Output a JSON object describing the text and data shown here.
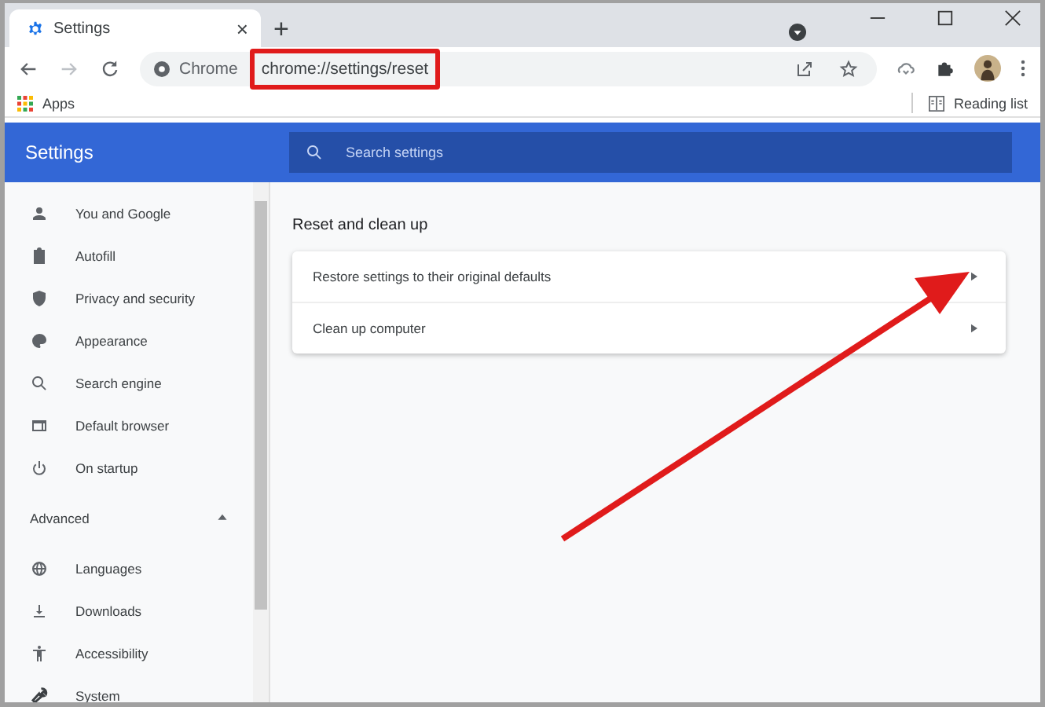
{
  "tab": {
    "title": "Settings",
    "close": "×"
  },
  "new_tab": "+",
  "toolbar": {
    "site_label": "Chrome",
    "url": "chrome://settings/reset"
  },
  "bookmarks": {
    "apps": "Apps",
    "reading_list": "Reading list"
  },
  "header": {
    "title": "Settings",
    "search": {
      "placeholder": "Search settings"
    }
  },
  "sidebar": {
    "items": [
      {
        "label": "You and Google"
      },
      {
        "label": "Autofill"
      },
      {
        "label": "Privacy and security"
      },
      {
        "label": "Appearance"
      },
      {
        "label": "Search engine"
      },
      {
        "label": "Default browser"
      },
      {
        "label": "On startup"
      }
    ],
    "advanced": {
      "label": "Advanced",
      "expanded": true,
      "items": [
        {
          "label": "Languages"
        },
        {
          "label": "Downloads"
        },
        {
          "label": "Accessibility"
        },
        {
          "label": "System"
        }
      ]
    }
  },
  "section": {
    "title": "Reset and clean up",
    "rows": [
      {
        "label": "Restore settings to their original defaults"
      },
      {
        "label": "Clean up computer"
      }
    ]
  }
}
